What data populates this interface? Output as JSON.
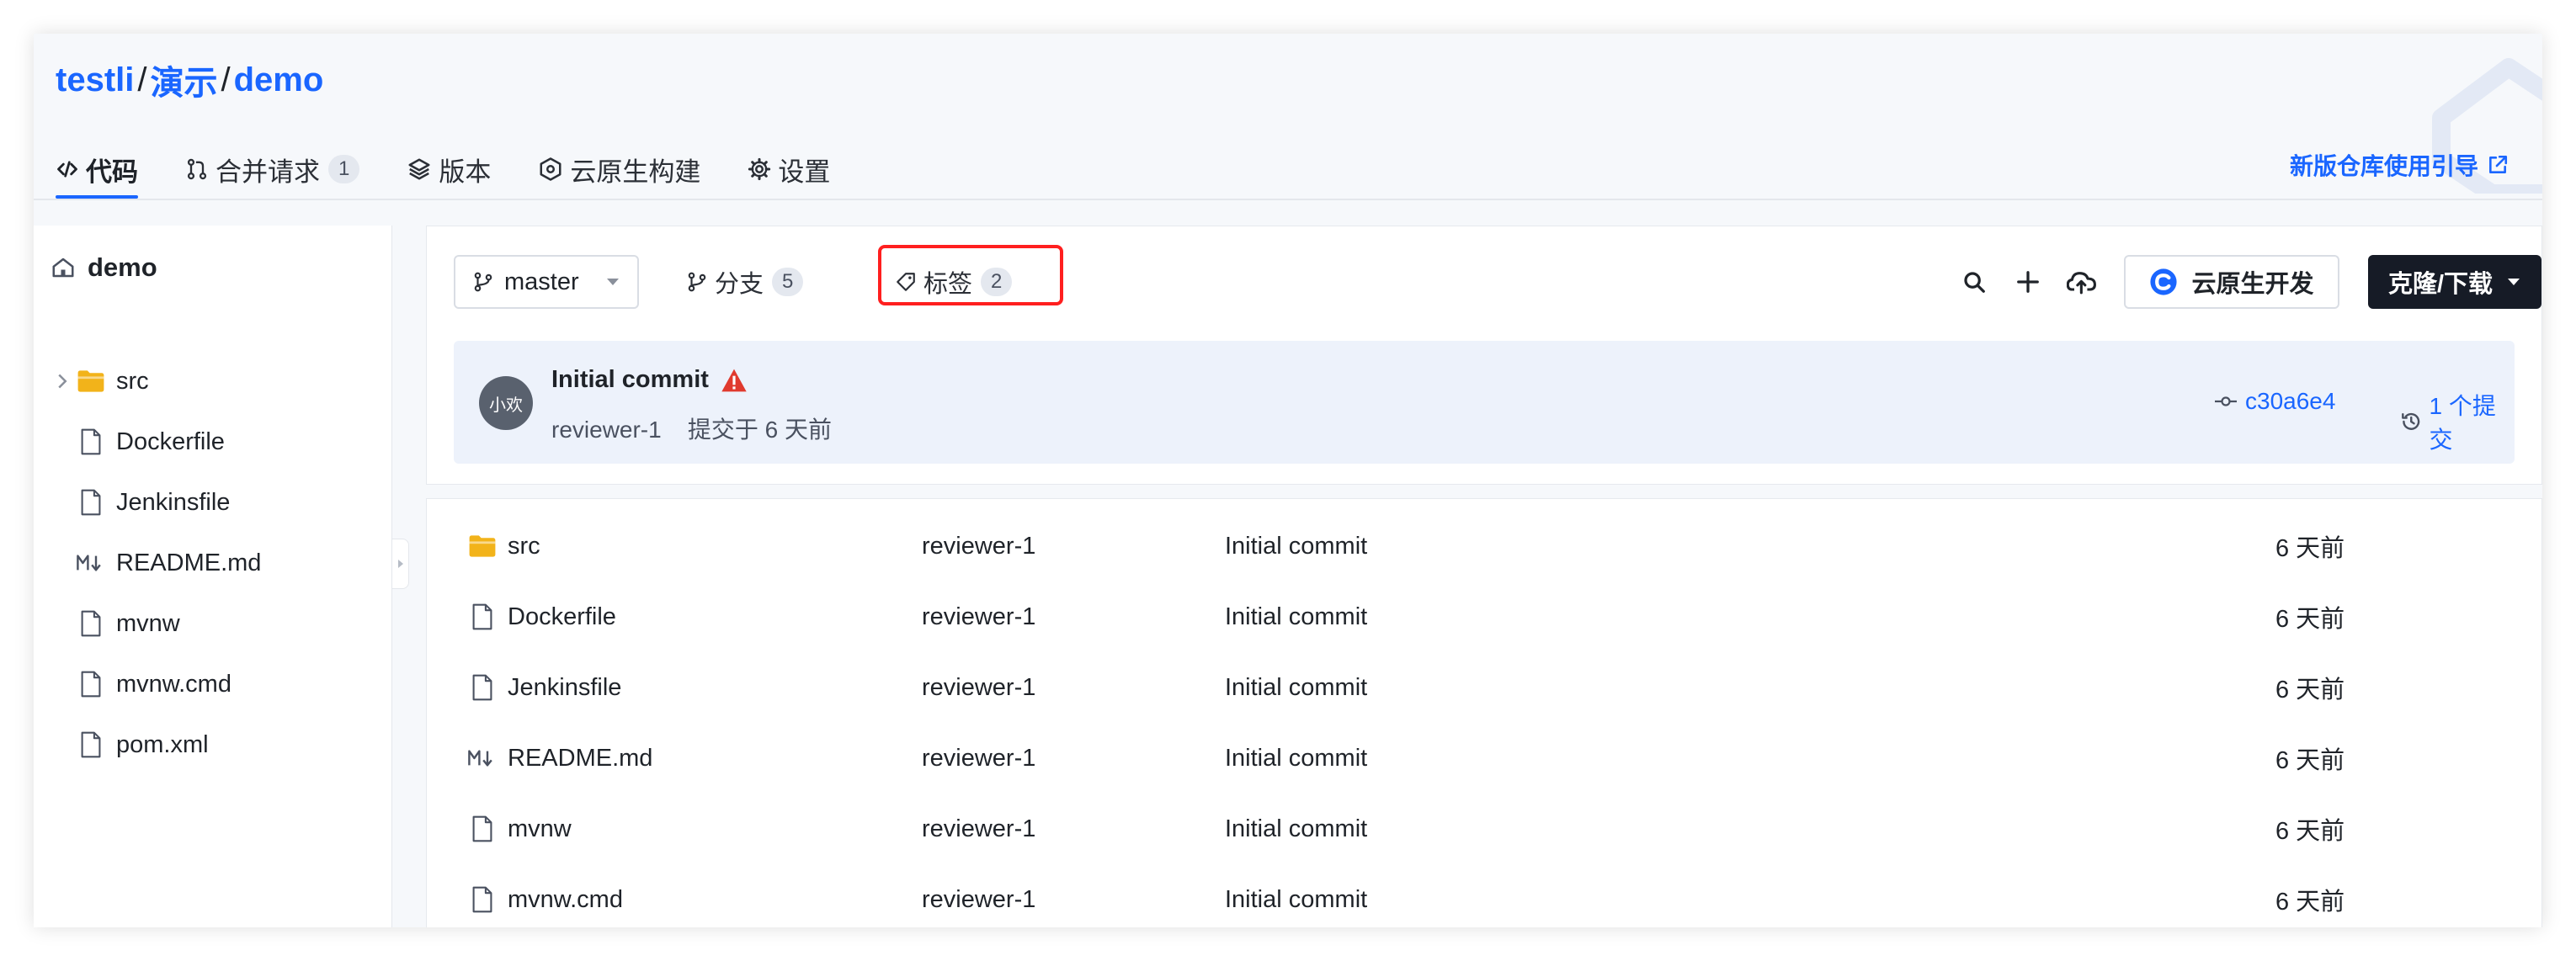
{
  "breadcrumb": {
    "owner": "testli",
    "group": "演示",
    "repo": "demo",
    "separator": "/"
  },
  "tabs": [
    {
      "label": "代码",
      "icon": "code-icon",
      "active": true
    },
    {
      "label": "合并请求",
      "icon": "merge-request-icon",
      "count": "1"
    },
    {
      "label": "版本",
      "icon": "layers-icon"
    },
    {
      "label": "云原生构建",
      "icon": "build-icon"
    },
    {
      "label": "设置",
      "icon": "gear-icon"
    }
  ],
  "guide_link": {
    "label": "新版仓库使用引导",
    "icon": "external-link-icon"
  },
  "sidebar": {
    "title": "demo",
    "items": [
      {
        "label": "src",
        "type": "folder",
        "icon": "folder-icon"
      },
      {
        "label": "Dockerfile",
        "type": "file",
        "icon": "file-icon"
      },
      {
        "label": "Jenkinsfile",
        "type": "file",
        "icon": "file-icon"
      },
      {
        "label": "README.md",
        "type": "markdown",
        "icon": "markdown-icon"
      },
      {
        "label": "mvnw",
        "type": "file",
        "icon": "file-icon"
      },
      {
        "label": "mvnw.cmd",
        "type": "file",
        "icon": "file-icon"
      },
      {
        "label": "pom.xml",
        "type": "file",
        "icon": "file-icon"
      }
    ]
  },
  "toolbar": {
    "branch": "master",
    "branches_label": "分支",
    "branches_count": "5",
    "tags_label": "标签",
    "tags_count": "2",
    "cloud_dev_label": "云原生开发",
    "clone_label": "克隆/下载"
  },
  "commit": {
    "avatar_text": "小欢",
    "message": "Initial commit",
    "author": "reviewer-1",
    "meta_text": "提交于 6 天前",
    "hash": "c30a6e4",
    "commit_count_label": "1 个提交"
  },
  "files": [
    {
      "name": "src",
      "icon": "folder-icon",
      "author": "reviewer-1",
      "message": "Initial commit",
      "time": "6 天前"
    },
    {
      "name": "Dockerfile",
      "icon": "file-icon",
      "author": "reviewer-1",
      "message": "Initial commit",
      "time": "6 天前"
    },
    {
      "name": "Jenkinsfile",
      "icon": "file-icon",
      "author": "reviewer-1",
      "message": "Initial commit",
      "time": "6 天前"
    },
    {
      "name": "README.md",
      "icon": "markdown-icon",
      "author": "reviewer-1",
      "message": "Initial commit",
      "time": "6 天前"
    },
    {
      "name": "mvnw",
      "icon": "file-icon",
      "author": "reviewer-1",
      "message": "Initial commit",
      "time": "6 天前"
    },
    {
      "name": "mvnw.cmd",
      "icon": "file-icon",
      "author": "reviewer-1",
      "message": "Initial commit",
      "time": "6 天前"
    }
  ],
  "colors": {
    "accent": "#1a66ff",
    "highlight": "#ff1f1f",
    "warning": "#e03a2e",
    "folder": "#f2b31a",
    "clone_bg": "#161b26"
  }
}
